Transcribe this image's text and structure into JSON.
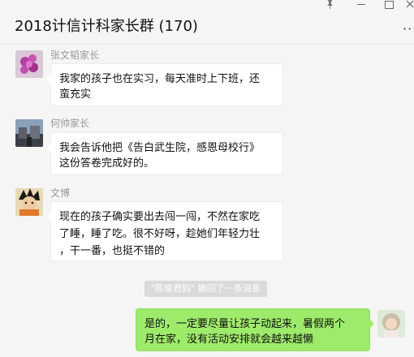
{
  "header": {
    "title": "2018计信计科家长群 (170)",
    "more_label": "···"
  },
  "messages": [
    {
      "sender": "张文韬家长",
      "text_line1": "我家的孩子也在实习，每天准时上下班，还",
      "text_line2": "蛮充实",
      "avatar": "flower-avatar",
      "avatar_color": "#c04fb0"
    },
    {
      "sender": "何帅家长",
      "text_line1": "我会告诉他把《告白武生院，感恩母校行》",
      "text_line2": "这份答卷完成好的。",
      "avatar": "building-avatar",
      "avatar_color": "#6a6f7a"
    },
    {
      "sender": "文博",
      "text_line1": "现在的孩子确实要出去闯一闯，不然在家吃",
      "text_line2": "了睡，睡了吃。很不好呀，趁她们年轻力壮",
      "text_line3": "，干一番，也挺不错的",
      "avatar": "cartoon-avatar",
      "avatar_color": "#4a3b22"
    }
  ],
  "recall_notice": {
    "who": "\"陈俊君妈\"",
    "text": " 撤回了一条消息"
  },
  "my_message": {
    "text_line1": "是的，一定要尽量让孩子动起来，暑假两个",
    "text_line2": "月在家，没有活动安排就会越来越懒",
    "avatar": "girl-avatar",
    "bubble_color": "#9eea6a"
  }
}
